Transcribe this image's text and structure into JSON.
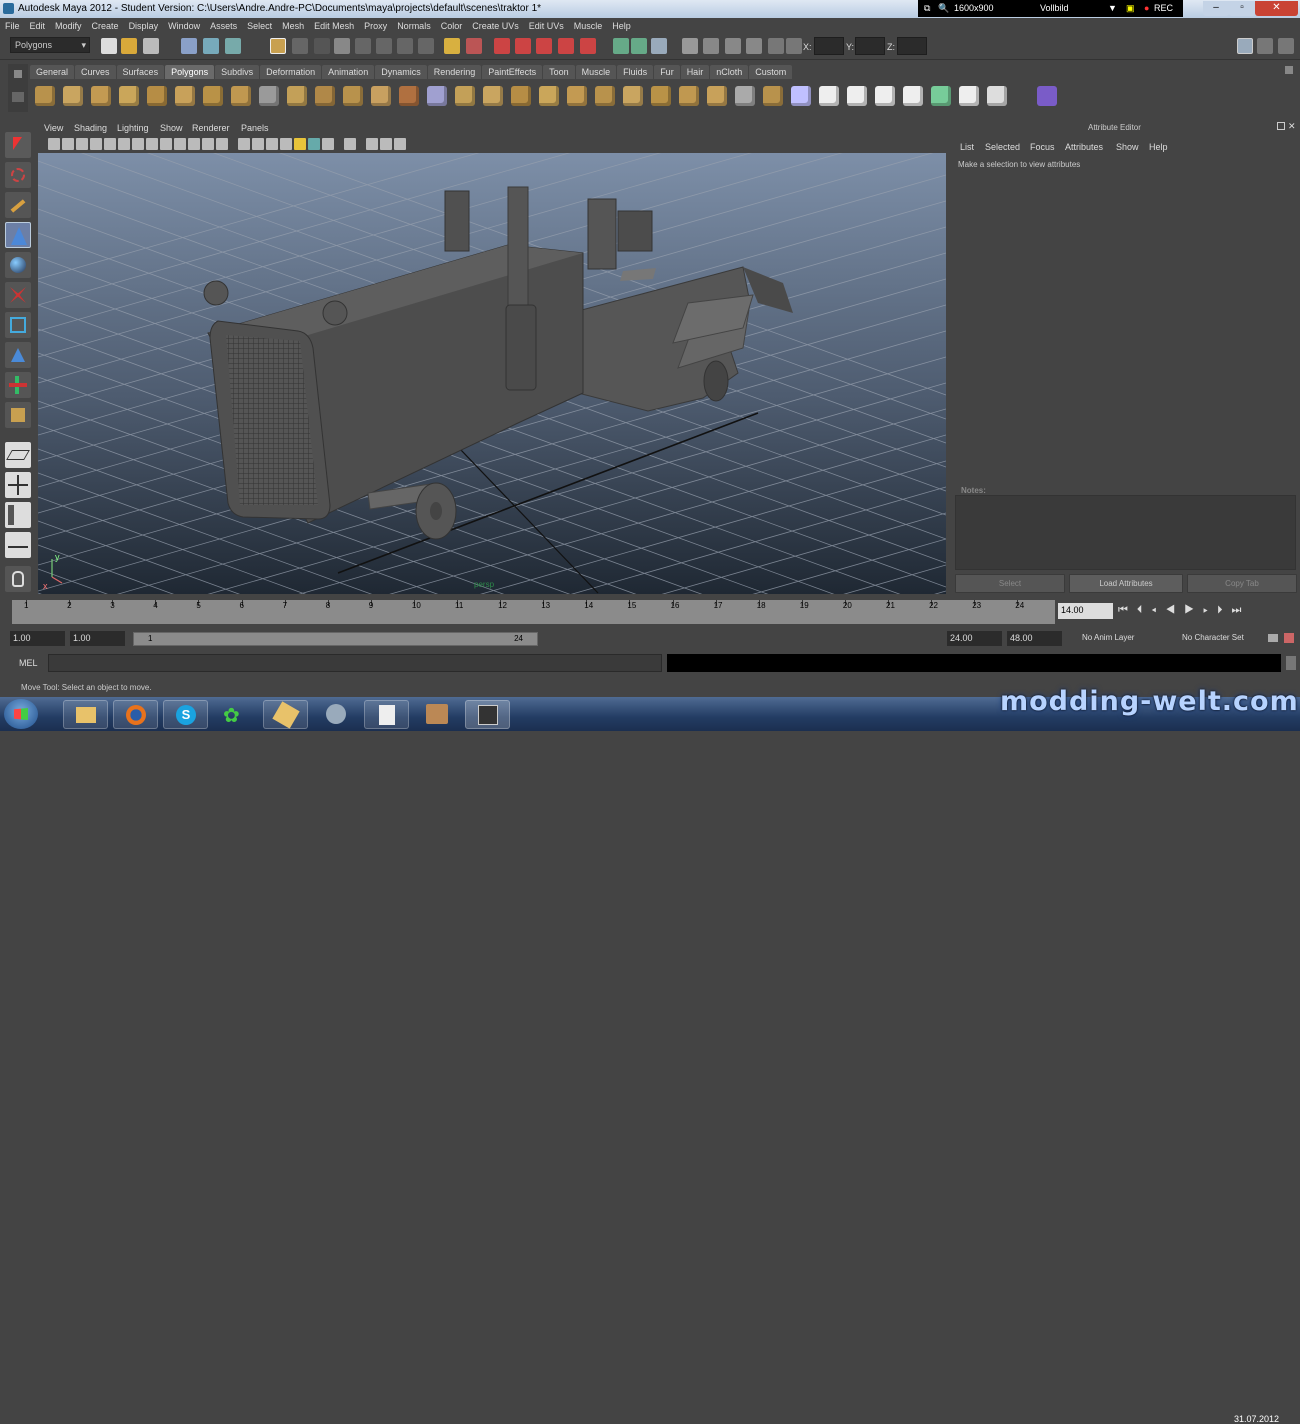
{
  "window": {
    "title": "Autodesk Maya 2012 - Student Version: C:\\Users\\Andre.Andre-PC\\Documents\\maya\\projects\\default\\scenes\\traktor 1*",
    "recorder": {
      "resolution": "1600x900",
      "mode": "Vollbild",
      "rec_label": "REC"
    }
  },
  "menubar": [
    "File",
    "Edit",
    "Modify",
    "Create",
    "Display",
    "Window",
    "Assets",
    "Select",
    "Mesh",
    "Edit Mesh",
    "Proxy",
    "Normals",
    "Color",
    "Create UVs",
    "Edit UVs",
    "Muscle",
    "Help"
  ],
  "statusline": {
    "menu_set": "Polygons",
    "x_label": "X:",
    "y_label": "Y:",
    "z_label": "Z:"
  },
  "shelf": {
    "tabs": [
      "General",
      "Curves",
      "Surfaces",
      "Polygons",
      "Subdivs",
      "Deformation",
      "Animation",
      "Dynamics",
      "Rendering",
      "PaintEffects",
      "Toon",
      "Muscle",
      "Fluids",
      "Fur",
      "Hair",
      "nCloth",
      "Custom"
    ],
    "active_tab": "Polygons"
  },
  "viewport": {
    "menus": [
      "View",
      "Shading",
      "Lighting",
      "Show",
      "Renderer",
      "Panels"
    ],
    "axis_y": "y",
    "axis_x": "x",
    "camera": "persp"
  },
  "attribute_editor": {
    "title": "Attribute Editor",
    "menus": [
      "List",
      "Selected",
      "Focus",
      "Attributes",
      "Show",
      "Help"
    ],
    "hint": "Make a selection to view attributes",
    "notes_label": "Notes:",
    "buttons": {
      "select": "Select",
      "load": "Load Attributes",
      "copy": "Copy Tab"
    }
  },
  "timeslider": {
    "ticks": [
      "1",
      "2",
      "3",
      "4",
      "5",
      "6",
      "7",
      "8",
      "9",
      "10",
      "11",
      "12",
      "13",
      "14",
      "15",
      "16",
      "17",
      "18",
      "19",
      "20",
      "21",
      "22",
      "23",
      "24"
    ],
    "current_time": "14.00"
  },
  "range": {
    "start": "1.00",
    "playback_start": "1.00",
    "range_start_label": "1",
    "range_end_label": "24",
    "playback_end": "24.00",
    "end": "48.00",
    "anim_layer": "No Anim Layer",
    "character_set": "No Character Set"
  },
  "command": {
    "label": "MEL"
  },
  "help": {
    "text": "Move Tool: Select an object to move."
  },
  "taskbar": {
    "date": "31.07.2012"
  },
  "watermark": "modding-welt.com",
  "colors": {
    "accent": "#6f8fb6",
    "viewport_top": "#7d8fa8",
    "viewport_bottom": "#1f2833",
    "grid": "#97a0ae"
  }
}
